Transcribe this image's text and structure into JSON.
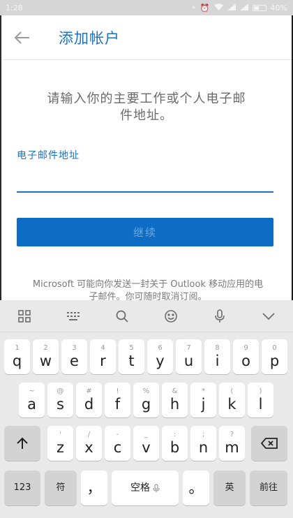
{
  "status_bar": {
    "time": "1:28",
    "battery": "40%"
  },
  "header": {
    "title": "添加帐户"
  },
  "main": {
    "prompt": "请输入你的主要工作或个人电子邮件地址。",
    "email_label": "电子邮件地址",
    "email_value": "",
    "continue_label": "继续",
    "disclaimer": "Microsoft 可能向你发送一封关于 Outlook 移动应用的电子邮件。你可随时取消订阅。"
  },
  "keyboard": {
    "row1": [
      {
        "hint": "1",
        "key": "q"
      },
      {
        "hint": "2",
        "key": "w"
      },
      {
        "hint": "3",
        "key": "e"
      },
      {
        "hint": "4",
        "key": "r"
      },
      {
        "hint": "5",
        "key": "t"
      },
      {
        "hint": "6",
        "key": "y"
      },
      {
        "hint": "7",
        "key": "u"
      },
      {
        "hint": "8",
        "key": "i"
      },
      {
        "hint": "9",
        "key": "o"
      },
      {
        "hint": "0",
        "key": "p"
      }
    ],
    "row2": [
      {
        "hint": "~",
        "key": "a"
      },
      {
        "hint": "@",
        "key": "s"
      },
      {
        "hint": "#",
        "key": "d"
      },
      {
        "hint": "!",
        "key": "f"
      },
      {
        "hint": "%",
        "key": "g"
      },
      {
        "hint": "&",
        "key": "h"
      },
      {
        "hint": "*",
        "key": "j"
      },
      {
        "hint": "(",
        "key": "k"
      },
      {
        "hint": ")",
        "key": "l"
      }
    ],
    "row3": [
      {
        "hint": "'",
        "key": "z"
      },
      {
        "hint": "/",
        "key": "x"
      },
      {
        "hint": "-",
        "key": "c"
      },
      {
        "hint": "_",
        "key": "v"
      },
      {
        "hint": ":",
        "key": "b"
      },
      {
        "hint": ";",
        "key": "n"
      },
      {
        "hint": "?",
        "key": "m"
      }
    ],
    "num_label": "123",
    "symbol_label": "符",
    "comma_label": "，",
    "space_label": "空格",
    "period_label": "。",
    "lang_label": "英",
    "enter_label": "前往"
  }
}
